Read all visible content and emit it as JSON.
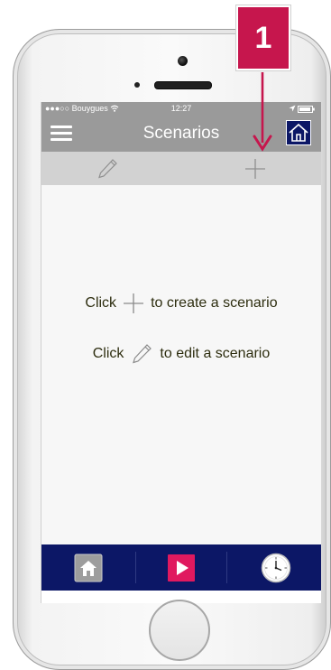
{
  "status_bar": {
    "carrier": "●●●○○ Bouygues",
    "time": "12:27"
  },
  "nav": {
    "title": "Scenarios"
  },
  "toolbar": {
    "edit_icon": "pencil-icon",
    "add_icon": "plus-icon"
  },
  "hints": {
    "create_prefix": "Click",
    "create_suffix": "to create a scenario",
    "edit_prefix": "Click",
    "edit_suffix": "to edit a scenario"
  },
  "tabs": [
    {
      "icon": "home-icon"
    },
    {
      "icon": "play-icon"
    },
    {
      "icon": "clock-icon"
    }
  ],
  "annotation": {
    "number": "1"
  },
  "colors": {
    "nav_gray": "#9a9a9a",
    "toolbar_gray": "#d2d2d2",
    "navy": "#0c1766",
    "accent_pink": "#c6164d",
    "hint_text": "#2e2e10"
  }
}
